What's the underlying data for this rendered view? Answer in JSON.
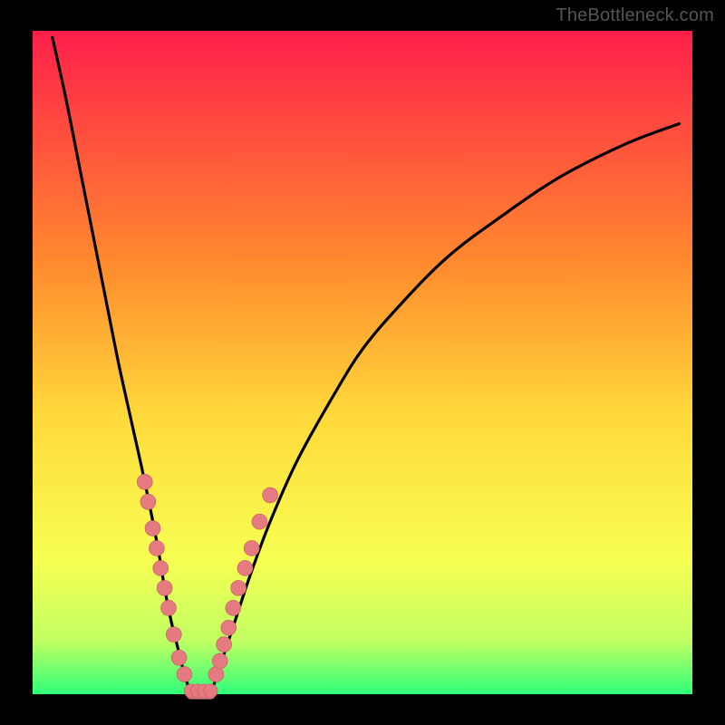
{
  "watermark": "TheBottleneck.com",
  "colors": {
    "frame": "#000000",
    "gradient_top": "#ff1f4b",
    "gradient_mid_upper": "#ff8a2e",
    "gradient_mid": "#ffd93a",
    "gradient_mid_lower": "#f6ff52",
    "gradient_lower": "#c0ff62",
    "gradient_bottom": "#2fff7a",
    "curve_stroke": "#000000",
    "dot_fill": "#e57b80",
    "dot_stroke": "#c15b60"
  },
  "chart_data": {
    "type": "line",
    "title": "",
    "xlabel": "",
    "ylabel": "",
    "xlim": [
      0,
      100
    ],
    "ylim": [
      0,
      100
    ],
    "series": [
      {
        "name": "left-curve",
        "x": [
          3,
          5,
          7,
          9,
          11,
          13,
          15,
          17,
          19,
          20,
          21,
          22,
          23,
          24
        ],
        "y": [
          99,
          90,
          80,
          70,
          60,
          50,
          41,
          32,
          22,
          16,
          11,
          7,
          3,
          0
        ]
      },
      {
        "name": "right-curve",
        "x": [
          27,
          28,
          29,
          30,
          31,
          33,
          36,
          40,
          45,
          50,
          56,
          63,
          71,
          80,
          90,
          98
        ],
        "y": [
          0,
          3,
          6,
          9,
          12,
          18,
          26,
          35,
          44,
          52,
          59,
          66,
          72,
          78,
          83,
          86
        ]
      },
      {
        "name": "valley-flat",
        "x": [
          24,
          25,
          26,
          27
        ],
        "y": [
          0,
          0,
          0,
          0
        ]
      }
    ],
    "dots_left": [
      {
        "x": 17.0,
        "y": 32
      },
      {
        "x": 17.5,
        "y": 29
      },
      {
        "x": 18.2,
        "y": 25
      },
      {
        "x": 18.8,
        "y": 22
      },
      {
        "x": 19.4,
        "y": 19
      },
      {
        "x": 20.0,
        "y": 16
      },
      {
        "x": 20.6,
        "y": 13
      },
      {
        "x": 21.4,
        "y": 9
      },
      {
        "x": 22.2,
        "y": 5.5
      },
      {
        "x": 23.0,
        "y": 3
      }
    ],
    "dots_right": [
      {
        "x": 27.8,
        "y": 3
      },
      {
        "x": 28.4,
        "y": 5
      },
      {
        "x": 29.0,
        "y": 7.5
      },
      {
        "x": 29.7,
        "y": 10
      },
      {
        "x": 30.4,
        "y": 13
      },
      {
        "x": 31.2,
        "y": 16
      },
      {
        "x": 32.2,
        "y": 19
      },
      {
        "x": 33.2,
        "y": 22
      },
      {
        "x": 34.4,
        "y": 26
      },
      {
        "x": 36.0,
        "y": 30
      }
    ],
    "dots_bottom": [
      {
        "x": 24.0,
        "y": 0.5
      },
      {
        "x": 25.0,
        "y": 0.5
      },
      {
        "x": 26.0,
        "y": 0.5
      },
      {
        "x": 27.0,
        "y": 0.5
      }
    ]
  }
}
